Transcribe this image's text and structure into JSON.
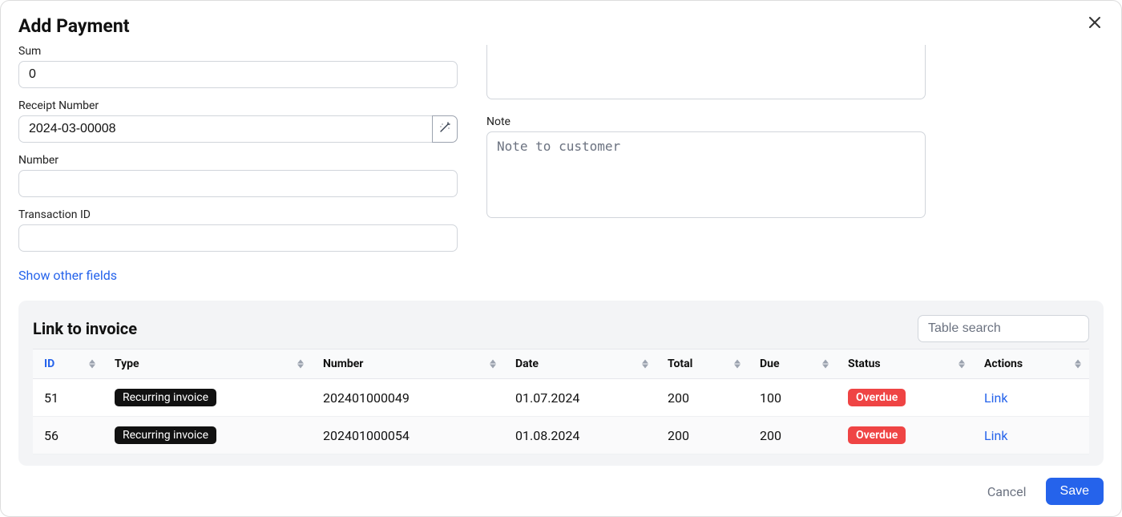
{
  "modal": {
    "title": "Add Payment"
  },
  "form": {
    "sum": {
      "label": "Sum",
      "value": "0"
    },
    "receipt_number": {
      "label": "Receipt Number",
      "value": "2024-03-00008"
    },
    "number": {
      "label": "Number",
      "value": ""
    },
    "transaction_id": {
      "label": "Transaction ID",
      "value": ""
    },
    "note": {
      "label": "Note",
      "placeholder": "Note to customer",
      "value": ""
    },
    "show_other_fields": "Show other fields"
  },
  "invoice_panel": {
    "title": "Link to invoice",
    "search_placeholder": "Table search",
    "columns": {
      "id": "ID",
      "type": "Type",
      "number": "Number",
      "date": "Date",
      "total": "Total",
      "due": "Due",
      "status": "Status",
      "actions": "Actions"
    },
    "rows": [
      {
        "id": "51",
        "type": "Recurring invoice",
        "number": "202401000049",
        "date": "01.07.2024",
        "total": "200",
        "due": "100",
        "status": "Overdue",
        "action": "Link"
      },
      {
        "id": "56",
        "type": "Recurring invoice",
        "number": "202401000054",
        "date": "01.08.2024",
        "total": "200",
        "due": "200",
        "status": "Overdue",
        "action": "Link"
      }
    ]
  },
  "footer": {
    "cancel": "Cancel",
    "save": "Save"
  }
}
